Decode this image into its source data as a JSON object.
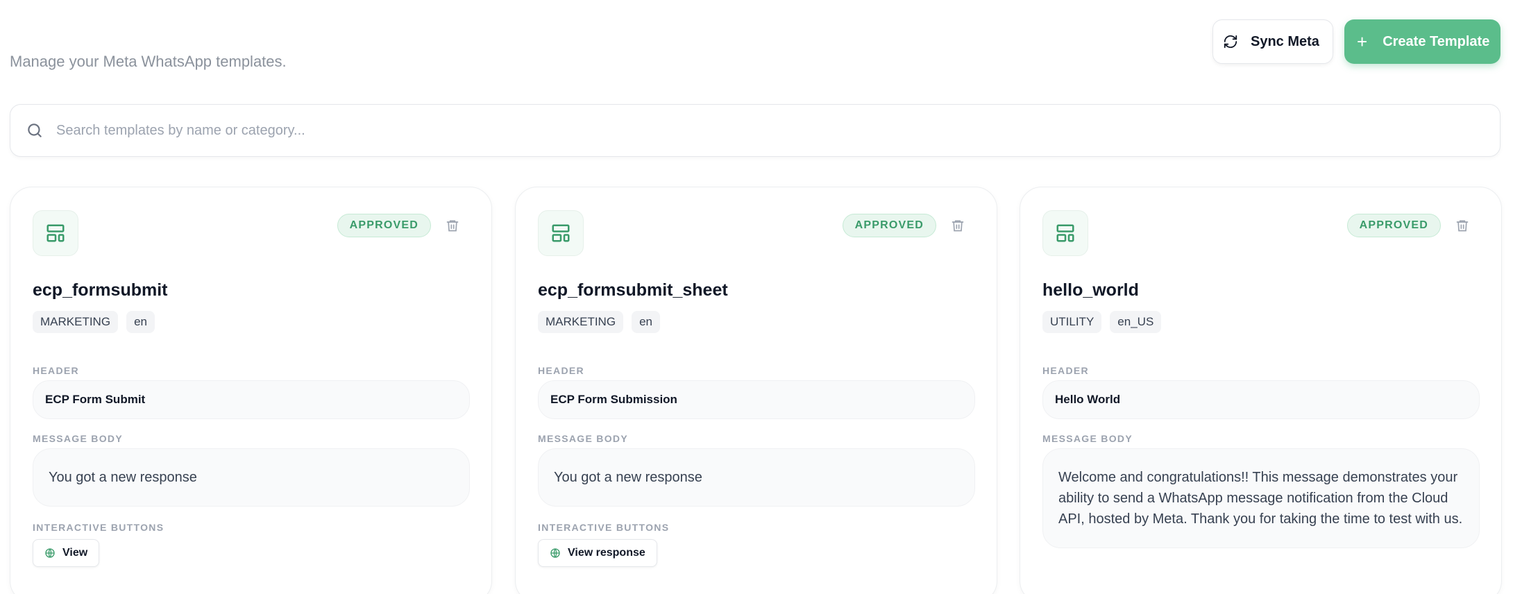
{
  "page": {
    "subtitle": "Manage your Meta WhatsApp templates.",
    "sync_label": "Sync Meta",
    "create_label": "Create Template",
    "plus_glyph": "+"
  },
  "search": {
    "placeholder": "Search templates by name or category..."
  },
  "labels": {
    "header": "HEADER",
    "message_body": "MESSAGE BODY",
    "interactive_buttons": "INTERACTIVE BUTTONS"
  },
  "colors": {
    "accent": "#5bbd8b",
    "status_text": "#3a9b6a",
    "status_bg": "#e8f6ee"
  },
  "icons": {
    "sync": "refresh-icon",
    "create": "plus-icon",
    "search": "search-icon",
    "template": "layout-template-icon",
    "delete": "trash-icon",
    "button": "globe-icon"
  },
  "templates": [
    {
      "name": "ecp_formsubmit",
      "status": "APPROVED",
      "category": "MARKETING",
      "language": "en",
      "header": "ECP Form Submit",
      "body": "You got a new response",
      "button": "View"
    },
    {
      "name": "ecp_formsubmit_sheet",
      "status": "APPROVED",
      "category": "MARKETING",
      "language": "en",
      "header": "ECP Form Submission",
      "body": "You got a new response",
      "button": "View response"
    },
    {
      "name": "hello_world",
      "status": "APPROVED",
      "category": "UTILITY",
      "language": "en_US",
      "header": "Hello World",
      "body": "Welcome and congratulations!! This message demonstrates your ability to send a WhatsApp message notification from the Cloud API, hosted by Meta. Thank you for taking the time to test with us."
    }
  ]
}
